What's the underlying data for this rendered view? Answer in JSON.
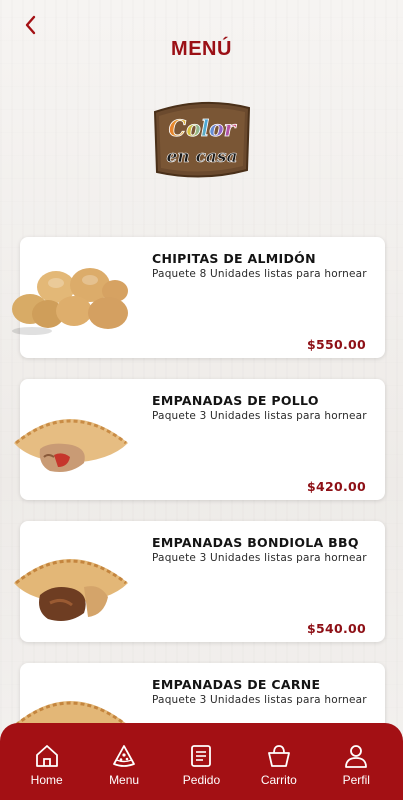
{
  "header": {
    "title": "MENÚ",
    "logo_line1": "Color",
    "logo_line2": "en casa"
  },
  "products": [
    {
      "name": "CHIPITAS DE ALMIDÓN",
      "description": "Paquete 8 Unidades listas para hornear",
      "price": "$550.00"
    },
    {
      "name": "EMPANADAS DE POLLO",
      "description": "Paquete 3 Unidades listas para hornear",
      "price": "$420.00"
    },
    {
      "name": "EMPANADAS BONDIOLA BBQ",
      "description": "Paquete 3 Unidades listas para hornear",
      "price": "$540.00"
    },
    {
      "name": "EMPANADAS DE CARNE",
      "description": "Paquete 3 Unidades listas para hornear",
      "price": ""
    }
  ],
  "nav": {
    "items": [
      {
        "label": "Home",
        "icon": "home-icon"
      },
      {
        "label": "Menu",
        "icon": "pizza-icon"
      },
      {
        "label": "Pedido",
        "icon": "receipt-icon"
      },
      {
        "label": "Carrito",
        "icon": "basket-icon"
      },
      {
        "label": "Perfil",
        "icon": "user-icon"
      }
    ]
  },
  "colors": {
    "brand": "#a31014",
    "title": "#9b1016",
    "price": "#8e1016"
  }
}
